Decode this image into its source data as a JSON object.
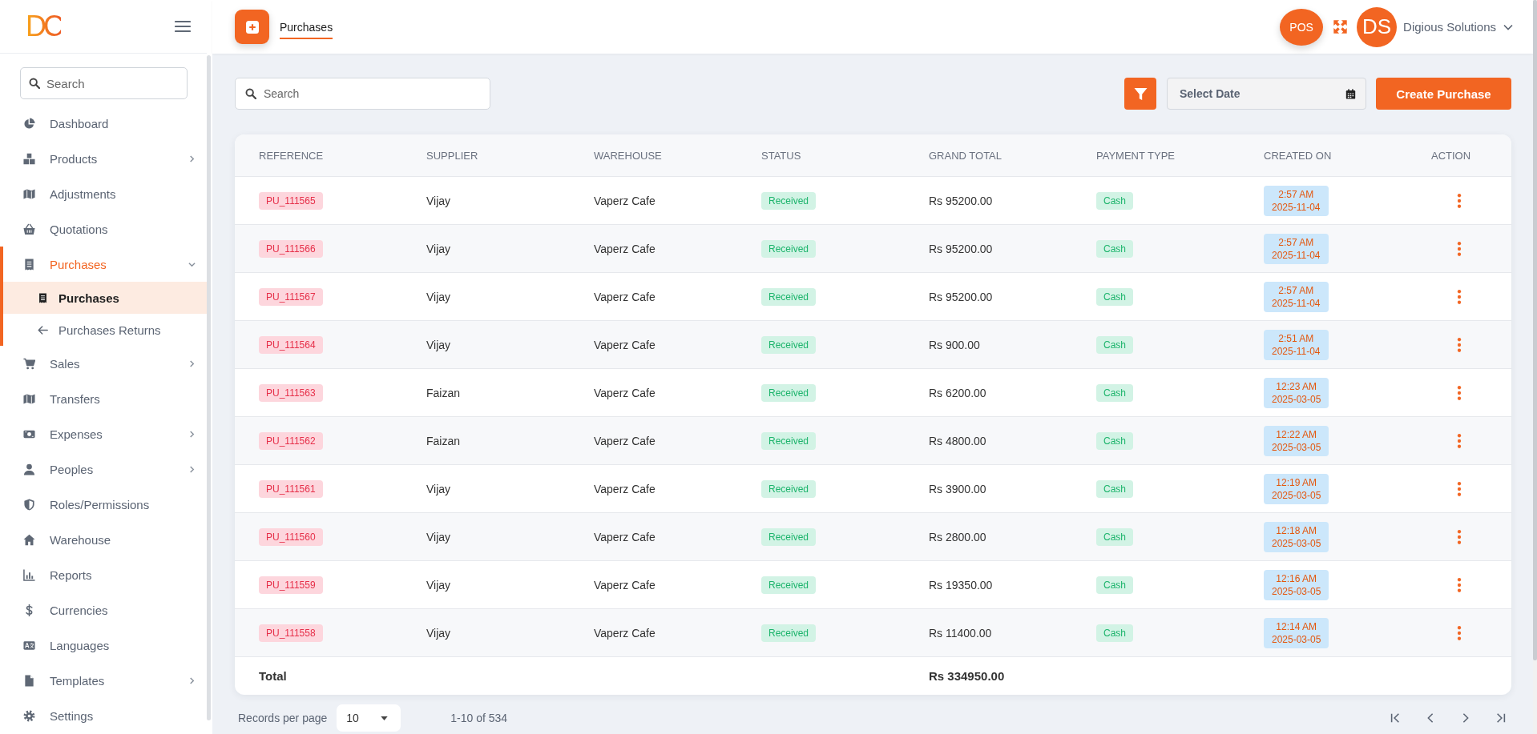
{
  "sidebar": {
    "logo": "DC",
    "search": {
      "placeholder": "Search"
    },
    "items": [
      {
        "label": "Dashboard",
        "selected": false
      },
      {
        "label": "Products",
        "selected": false,
        "expanded": false
      },
      {
        "label": "Adjustments",
        "selected": false
      },
      {
        "label": "Quotations",
        "selected": false
      },
      {
        "label": "Purchases",
        "selected": true,
        "expanded": true,
        "children": [
          {
            "label": "Purchases",
            "selected": true
          },
          {
            "label": "Purchases Returns",
            "selected": false
          }
        ]
      },
      {
        "label": "Sales",
        "selected": false,
        "expanded": false
      },
      {
        "label": "Transfers",
        "selected": false
      },
      {
        "label": "Expenses",
        "selected": false,
        "expanded": false
      },
      {
        "label": "Peoples",
        "selected": false,
        "expanded": false
      },
      {
        "label": "Roles/Permissions",
        "selected": false
      },
      {
        "label": "Warehouse",
        "selected": false
      },
      {
        "label": "Reports",
        "selected": false
      },
      {
        "label": "Currencies",
        "selected": false
      },
      {
        "label": "Languages",
        "selected": false
      },
      {
        "label": "Templates",
        "selected": false,
        "expanded": false
      },
      {
        "label": "Settings",
        "selected": false
      }
    ]
  },
  "header": {
    "tab": {
      "label": "Purchases",
      "selected": true
    },
    "pos_button": "POS",
    "avatar": "DS",
    "user_name": "Digious Solutions"
  },
  "toolbar": {
    "search": {
      "placeholder": "Search"
    },
    "date": {
      "placeholder": "Select Date"
    },
    "create_button": "Create Purchase"
  },
  "table": {
    "columns": [
      "REFERENCE",
      "SUPPLIER",
      "WAREHOUSE",
      "STATUS",
      "GRAND TOTAL",
      "PAYMENT TYPE",
      "CREATED ON",
      "ACTION"
    ],
    "rows": [
      {
        "reference": "PU_111565",
        "supplier": "Vijay",
        "warehouse": "Vaperz Cafe",
        "status": "Received",
        "grand_total": "Rs 95200.00",
        "payment_type": "Cash",
        "time": "2:57 AM",
        "date": "2025-11-04"
      },
      {
        "reference": "PU_111566",
        "supplier": "Vijay",
        "warehouse": "Vaperz Cafe",
        "status": "Received",
        "grand_total": "Rs 95200.00",
        "payment_type": "Cash",
        "time": "2:57 AM",
        "date": "2025-11-04"
      },
      {
        "reference": "PU_111567",
        "supplier": "Vijay",
        "warehouse": "Vaperz Cafe",
        "status": "Received",
        "grand_total": "Rs 95200.00",
        "payment_type": "Cash",
        "time": "2:57 AM",
        "date": "2025-11-04"
      },
      {
        "reference": "PU_111564",
        "supplier": "Vijay",
        "warehouse": "Vaperz Cafe",
        "status": "Received",
        "grand_total": "Rs 900.00",
        "payment_type": "Cash",
        "time": "2:51 AM",
        "date": "2025-11-04"
      },
      {
        "reference": "PU_111563",
        "supplier": "Faizan",
        "warehouse": "Vaperz Cafe",
        "status": "Received",
        "grand_total": "Rs 6200.00",
        "payment_type": "Cash",
        "time": "12:23 AM",
        "date": "2025-03-05"
      },
      {
        "reference": "PU_111562",
        "supplier": "Faizan",
        "warehouse": "Vaperz Cafe",
        "status": "Received",
        "grand_total": "Rs 4800.00",
        "payment_type": "Cash",
        "time": "12:22 AM",
        "date": "2025-03-05"
      },
      {
        "reference": "PU_111561",
        "supplier": "Vijay",
        "warehouse": "Vaperz Cafe",
        "status": "Received",
        "grand_total": "Rs 3900.00",
        "payment_type": "Cash",
        "time": "12:19 AM",
        "date": "2025-03-05"
      },
      {
        "reference": "PU_111560",
        "supplier": "Vijay",
        "warehouse": "Vaperz Cafe",
        "status": "Received",
        "grand_total": "Rs 2800.00",
        "payment_type": "Cash",
        "time": "12:18 AM",
        "date": "2025-03-05"
      },
      {
        "reference": "PU_111559",
        "supplier": "Vijay",
        "warehouse": "Vaperz Cafe",
        "status": "Received",
        "grand_total": "Rs 19350.00",
        "payment_type": "Cash",
        "time": "12:16 AM",
        "date": "2025-03-05"
      },
      {
        "reference": "PU_111558",
        "supplier": "Vijay",
        "warehouse": "Vaperz Cafe",
        "status": "Received",
        "grand_total": "Rs 11400.00",
        "payment_type": "Cash",
        "time": "12:14 AM",
        "date": "2025-03-05"
      }
    ],
    "total": {
      "label": "Total",
      "grand_total": "Rs 334950.00"
    }
  },
  "pagination": {
    "records_label": "Records per page",
    "per_page": "10",
    "range": "1-10 of 534"
  }
}
